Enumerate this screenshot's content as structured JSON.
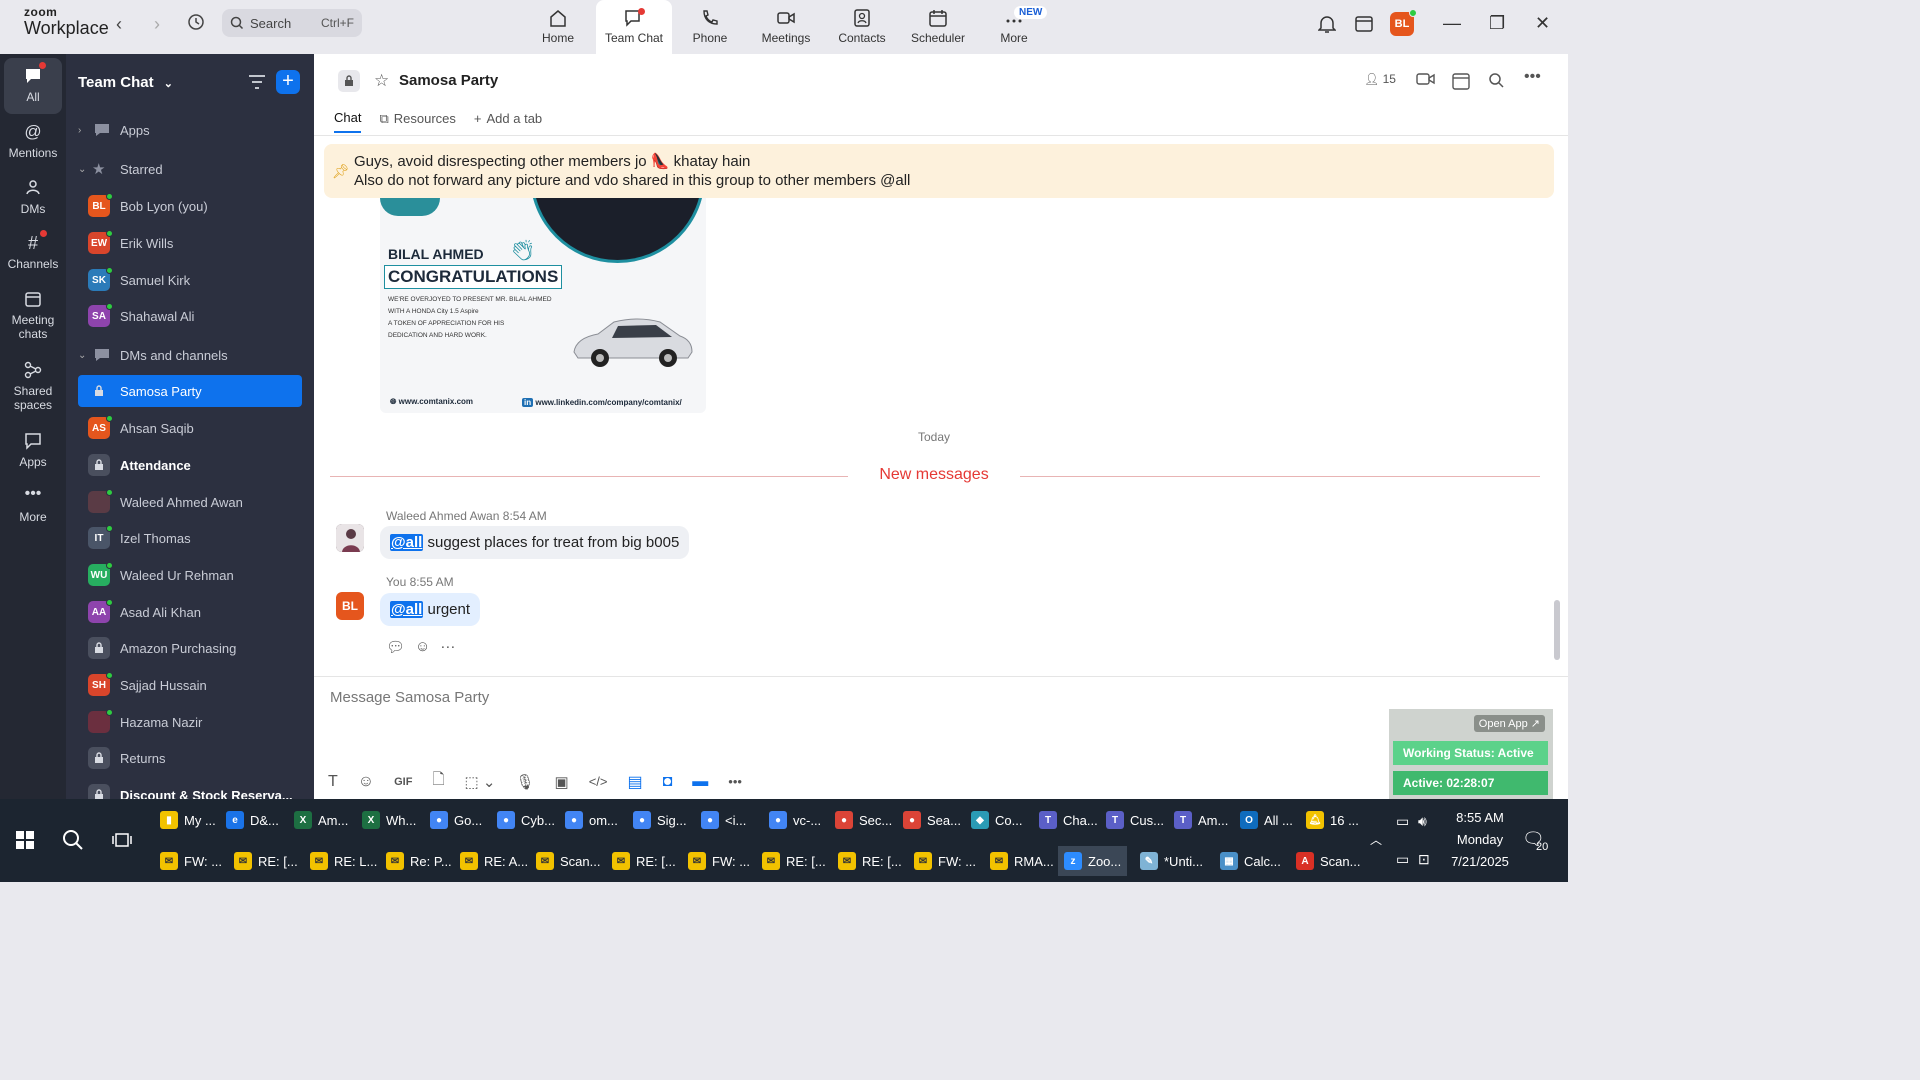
{
  "app": {
    "logo_line1": "zoom",
    "logo_line2": "Workplace"
  },
  "topbar": {
    "search_label": "Search",
    "search_shortcut": "Ctrl+F",
    "tabs": [
      {
        "label": "Home"
      },
      {
        "label": "Team Chat"
      },
      {
        "label": "Phone"
      },
      {
        "label": "Meetings"
      },
      {
        "label": "Contacts"
      },
      {
        "label": "Scheduler"
      },
      {
        "label": "More"
      }
    ],
    "new_badge": "NEW",
    "user_initials": "BL"
  },
  "rail": {
    "items": [
      {
        "label": "All"
      },
      {
        "label": "Mentions"
      },
      {
        "label": "DMs"
      },
      {
        "label": "Channels"
      },
      {
        "label": "Meeting chats"
      },
      {
        "label": "Shared spaces"
      },
      {
        "label": "Apps"
      },
      {
        "label": "More"
      }
    ]
  },
  "sidebar": {
    "title": "Team Chat",
    "sections": {
      "apps": "Apps",
      "starred": "Starred",
      "dms": "DMs and channels"
    },
    "starred": [
      {
        "initials": "BL",
        "name": "Bob Lyon (you)",
        "color": "#e5561d"
      },
      {
        "initials": "EW",
        "name": "Erik Wills",
        "color": "#d9452b"
      },
      {
        "initials": "SK",
        "name": "Samuel Kirk",
        "color": "#2b7bb9"
      },
      {
        "initials": "SA",
        "name": "Shahawal Ali",
        "color": "#8e44ad"
      }
    ],
    "channels": [
      {
        "name": "Samosa Party"
      },
      {
        "initials": "AS",
        "name": "Ahsan Saqib",
        "color": "#e5561d"
      },
      {
        "name": "Attendance"
      },
      {
        "name": "Waleed Ahmed Awan"
      },
      {
        "initials": "IT",
        "name": "Izel Thomas",
        "color": "#4a5568"
      },
      {
        "initials": "WU",
        "name": "Waleed Ur Rehman",
        "color": "#27ae60"
      },
      {
        "initials": "AA",
        "name": "Asad Ali Khan",
        "color": "#8e44ad"
      },
      {
        "name": "Amazon Purchasing"
      },
      {
        "initials": "SH",
        "name": "Sajjad Hussain",
        "color": "#d9452b"
      },
      {
        "name": "Hazama Nazir"
      },
      {
        "name": "Returns"
      },
      {
        "name": "Discount & Stock Reserva..."
      }
    ]
  },
  "channel": {
    "title": "Samosa Party",
    "member_count": "15",
    "tabs": {
      "chat": "Chat",
      "resources": "Resources",
      "add": "Add a tab"
    },
    "pinned_line1": "Guys, avoid disrespecting other members jo 👠 khatay hain",
    "pinned_line2": "Also do not forward any picture and vdo shared in this group to other members @all",
    "poster": {
      "name": "BILAL AHMED",
      "congrats": "CONGRATULATIONS",
      "line1": "WE'RE OVERJOYED TO PRESENT MR. BILAL AHMED",
      "line2": "WITH A HONDA City 1.5 Aspire",
      "line3": "A TOKEN OF APPRECIATION FOR HIS",
      "line4": "DEDICATION AND HARD WORK.",
      "web": "www.comtanix.com",
      "linkedin": "www.linkedin.com/company/comtanix/"
    },
    "today": "Today",
    "new_messages": "New messages",
    "messages": [
      {
        "sender": "Waleed Ahmed Awan",
        "time": "8:54 AM",
        "mention": "@all",
        "text": " suggest places for treat from big b005"
      },
      {
        "sender": "You",
        "time": "8:55 AM",
        "initials": "BL",
        "mention": "@all",
        "text": " urgent"
      }
    ],
    "composer_placeholder": "Message Samosa Party"
  },
  "widget": {
    "open_app": "Open App ↗",
    "working_status": "Working Status: Active",
    "active_timer": "Active: 02:28:07"
  },
  "taskbar": {
    "row1": [
      {
        "label": "My ...",
        "color": "#f2c200"
      },
      {
        "label": "D&...",
        "color": "#1a73e8"
      },
      {
        "label": "Am...",
        "color": "#1d6f42"
      },
      {
        "label": "Wh...",
        "color": "#1d6f42"
      },
      {
        "label": "Go...",
        "color": "#4285f4"
      },
      {
        "label": "Cyb...",
        "color": "#4285f4"
      },
      {
        "label": "om...",
        "color": "#4285f4"
      },
      {
        "label": "Sig...",
        "color": "#4285f4"
      },
      {
        "label": "<i...",
        "color": "#4285f4"
      },
      {
        "label": "vc-...",
        "color": "#4285f4"
      },
      {
        "label": "Sec...",
        "color": "#db4437"
      },
      {
        "label": "Sea...",
        "color": "#db4437"
      },
      {
        "label": "Co...",
        "color": "#2b9bb5"
      },
      {
        "label": "Cha...",
        "color": "#5b5fc7"
      },
      {
        "label": "Cus...",
        "color": "#5b5fc7"
      },
      {
        "label": "Am...",
        "color": "#5b5fc7"
      },
      {
        "label": "All ...",
        "color": "#0f6cbd"
      },
      {
        "label": "16 ...",
        "color": "#f2c200"
      }
    ],
    "row2": [
      {
        "label": "FW: ..."
      },
      {
        "label": "RE: [..."
      },
      {
        "label": "RE: L..."
      },
      {
        "label": "Re: P..."
      },
      {
        "label": "RE: A..."
      },
      {
        "label": "Scan..."
      },
      {
        "label": "RE: [..."
      },
      {
        "label": "FW: ..."
      },
      {
        "label": "RE: [..."
      },
      {
        "label": "RE: [..."
      },
      {
        "label": "FW: ..."
      },
      {
        "label": "RMA..."
      },
      {
        "label": "Zoo..."
      },
      {
        "label": "*Unti..."
      },
      {
        "label": "Calc..."
      },
      {
        "label": "Scan..."
      }
    ],
    "time": "8:55 AM",
    "day": "Monday",
    "date": "7/21/2025",
    "notifications": "20"
  }
}
